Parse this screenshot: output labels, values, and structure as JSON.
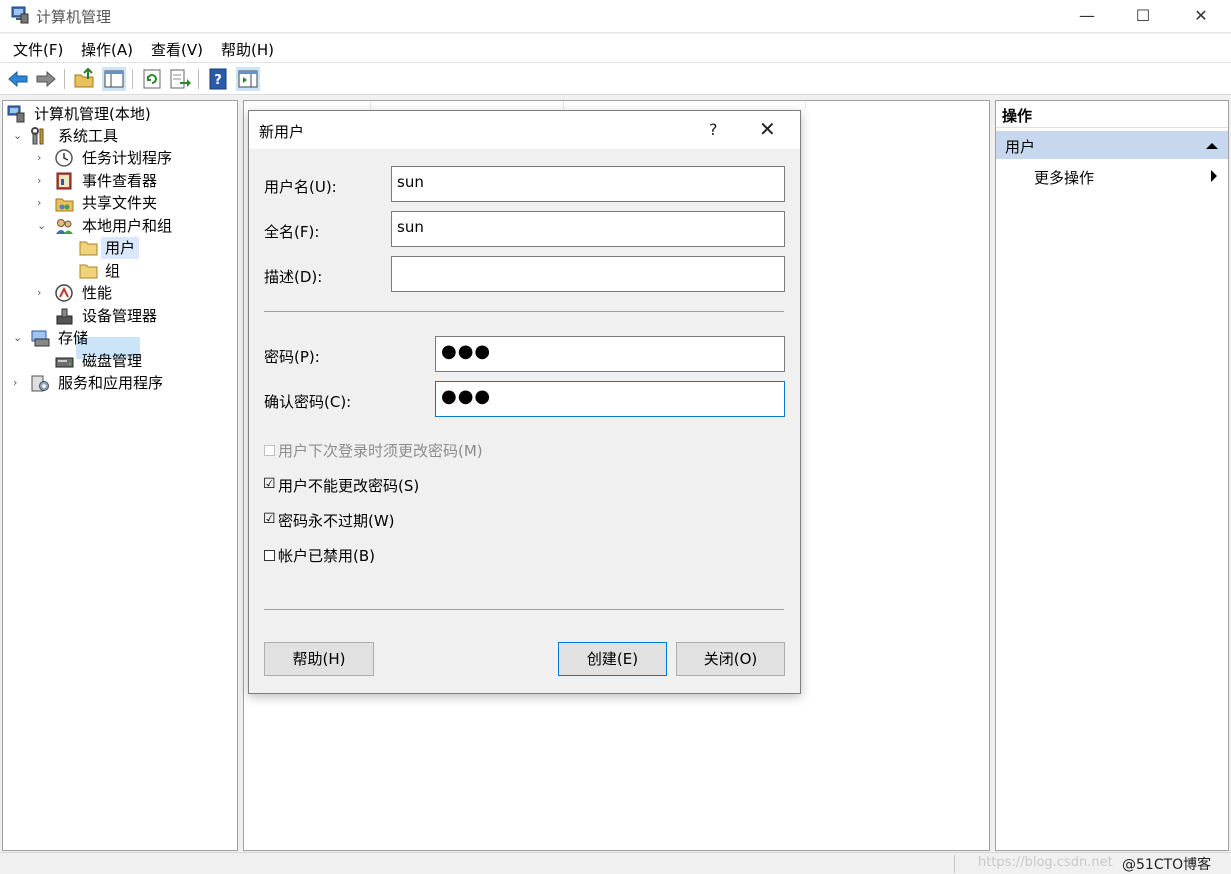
{
  "window": {
    "title": "计算机管理",
    "min": "—",
    "max": "☐",
    "close": "✕"
  },
  "menu": [
    "文件(F)",
    "操作(A)",
    "查看(V)",
    "帮助(H)"
  ],
  "tree": {
    "root": "计算机管理(本地)",
    "system_tools": "系统工具",
    "task_scheduler": "任务计划程序",
    "event_viewer": "事件查看器",
    "shared_folders": "共享文件夹",
    "local_users_groups": "本地用户和组",
    "users": "用户",
    "groups": "组",
    "performance": "性能",
    "device_manager": "设备管理器",
    "storage": "存储",
    "disk_management": "磁盘管理",
    "services_apps": "服务和应用程序"
  },
  "actions": {
    "title": "操作",
    "section": "用户",
    "more": "更多操作"
  },
  "dialog": {
    "title": "新用户",
    "help_glyph": "?",
    "close_glyph": "✕",
    "username_label": "用户名(U):",
    "username_value": "sun",
    "fullname_label": "全名(F):",
    "fullname_value": "sun",
    "description_label": "描述(D):",
    "description_value": "",
    "password_label": "密码(P):",
    "password_value": "●●●",
    "confirm_label": "确认密码(C):",
    "confirm_value": "●●●",
    "chk_must_change": "用户下次登录时须更改密码(M)",
    "chk_cannot_change": "用户不能更改密码(S)",
    "chk_never_expires": "密码永不过期(W)",
    "chk_disabled": "帐户已禁用(B)",
    "chk_must_change_checked": false,
    "chk_cannot_change_checked": true,
    "chk_never_expires_checked": true,
    "chk_disabled_checked": false,
    "help_button": "帮助(H)",
    "create_button": "创建(E)",
    "close_button": "关闭(O)"
  },
  "checkmark": "☑",
  "uncheck": "",
  "watermark": "https://blog.csdn.net",
  "watermark2": "@51CTO博客",
  "colors": {
    "selection": "#cce4f7",
    "actions_header": "#c7d7ee",
    "focus_border": "#0078d7"
  }
}
